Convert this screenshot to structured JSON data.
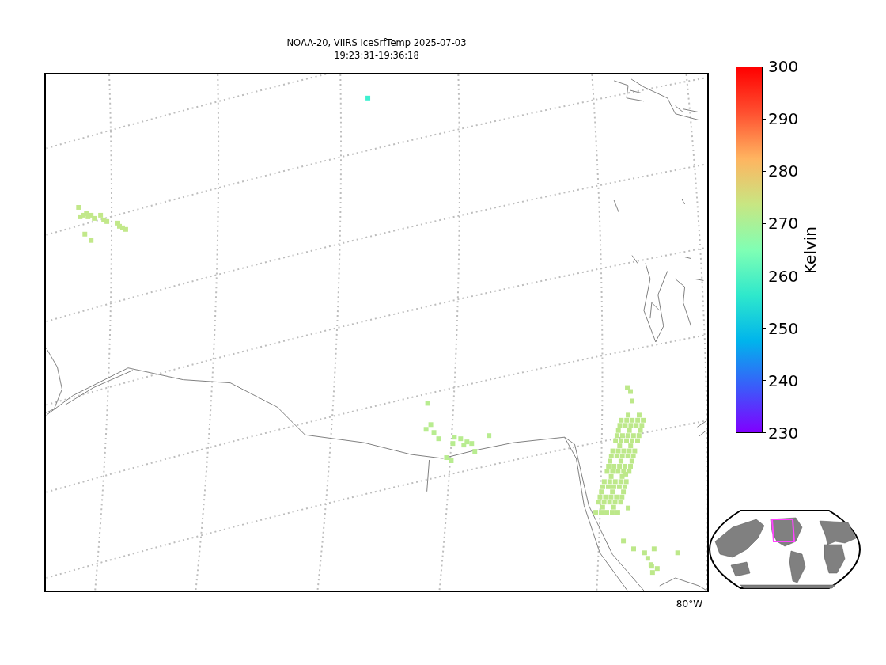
{
  "title": {
    "lines": [
      "NOAA-20, VIIRS IceSrfTemp 2025-07-03",
      "19:23:31-19:36:18"
    ]
  },
  "map": {
    "longitude_labels": [
      "80°W"
    ]
  },
  "colorbar": {
    "label": "Kelvin",
    "ticks": [
      "300",
      "290",
      "280",
      "270",
      "260",
      "250",
      "240",
      "230"
    ]
  }
}
